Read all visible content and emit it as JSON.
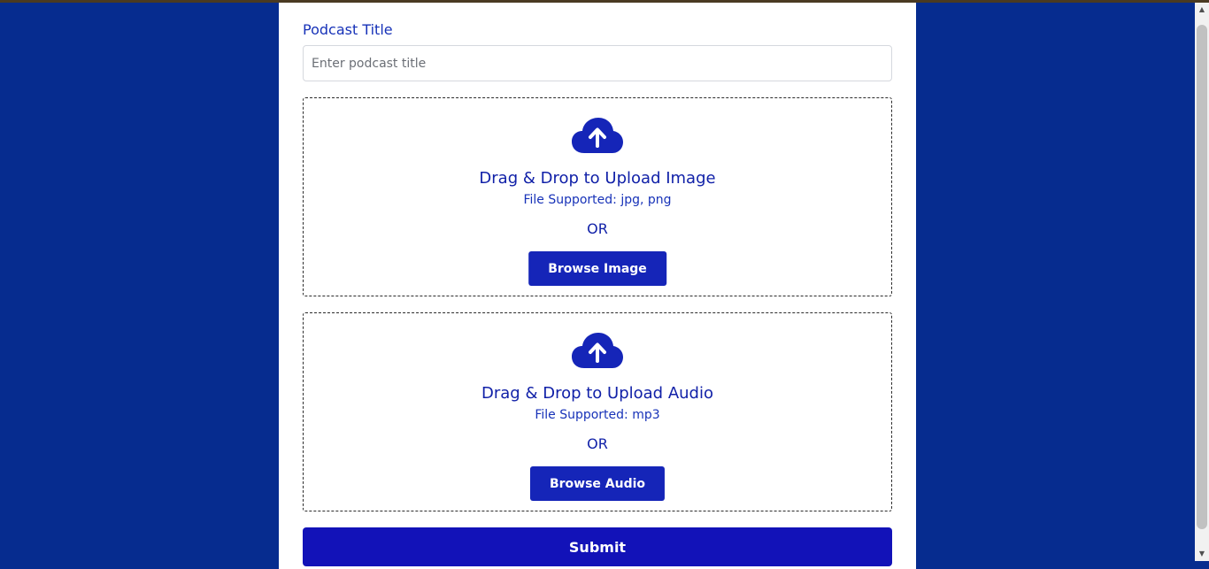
{
  "form": {
    "title_label": "Podcast Title",
    "title_value": "",
    "title_placeholder": "Enter podcast title",
    "image_upload": {
      "icon": "cloud-upload-icon",
      "title": "Drag & Drop to Upload Image",
      "supported": "File Supported: jpg, png",
      "or": "OR",
      "button": "Browse Image"
    },
    "audio_upload": {
      "icon": "cloud-upload-icon",
      "title": "Drag & Drop to Upload Audio",
      "supported": "File Supported: mp3",
      "or": "OR",
      "button": "Browse Audio"
    },
    "submit_label": "Submit"
  },
  "scrollbar": {
    "up_arrow": "▲",
    "down_arrow": "▼"
  },
  "colors": {
    "page_background": "#062c8f",
    "accent": "#1525b8",
    "submit": "#1212b8",
    "label_text": "#1732b8"
  }
}
